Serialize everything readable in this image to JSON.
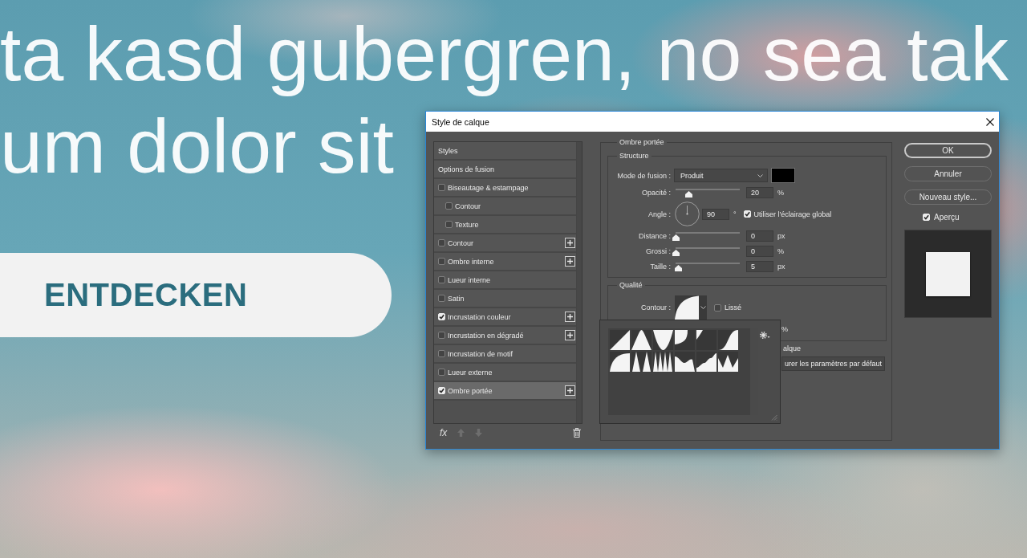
{
  "backdrop": {
    "headline": [
      "ta kasd gubergren, no sea tak",
      "um dolor sit"
    ],
    "button": {
      "label": "ENTDECKEN"
    }
  },
  "dialog": {
    "title": "Style de calque",
    "effects": [
      {
        "kind": "header",
        "label": "Styles",
        "selected": false
      },
      {
        "kind": "header",
        "label": "Options de fusion",
        "selected": false
      },
      {
        "kind": "effect",
        "label": "Biseautage & estampage",
        "checked": false,
        "addable": false,
        "selected": false,
        "children": [
          {
            "kind": "effect",
            "label": "Contour",
            "checked": false,
            "addable": false,
            "selected": false
          },
          {
            "kind": "effect",
            "label": "Texture",
            "checked": false,
            "addable": false,
            "selected": false
          }
        ]
      },
      {
        "kind": "effect",
        "label": "Contour",
        "checked": false,
        "addable": true,
        "selected": false
      },
      {
        "kind": "effect",
        "label": "Ombre interne",
        "checked": false,
        "addable": true,
        "selected": false
      },
      {
        "kind": "effect",
        "label": "Lueur interne",
        "checked": false,
        "addable": false,
        "selected": false
      },
      {
        "kind": "effect",
        "label": "Satin",
        "checked": false,
        "addable": false,
        "selected": false
      },
      {
        "kind": "effect",
        "label": "Incrustation couleur",
        "checked": true,
        "addable": true,
        "selected": false
      },
      {
        "kind": "effect",
        "label": "Incrustation en dégradé",
        "checked": false,
        "addable": true,
        "selected": false
      },
      {
        "kind": "effect",
        "label": "Incrustation de motif",
        "checked": false,
        "addable": false,
        "selected": false
      },
      {
        "kind": "effect",
        "label": "Lueur externe",
        "checked": false,
        "addable": false,
        "selected": false
      },
      {
        "kind": "effect",
        "label": "Ombre portée",
        "checked": true,
        "addable": true,
        "selected": true
      }
    ],
    "effects_toolbar": [
      {
        "kind": "fx",
        "label": "fx",
        "disabled": false
      },
      {
        "kind": "move_up",
        "disabled": true
      },
      {
        "kind": "move_down",
        "disabled": true
      },
      {
        "kind": "delete",
        "disabled": false
      }
    ],
    "panel": {
      "title": "Ombre portée",
      "structure": {
        "title": "Structure",
        "rows": [
          {
            "kind": "select",
            "label": "Mode de fusion :",
            "value": "Produit",
            "color": "#000000"
          },
          {
            "kind": "slider",
            "label": "Opacité :",
            "level": 0.2,
            "value": "20",
            "unit": "%"
          },
          {
            "kind": "angle",
            "label": "Angle :",
            "value": "90",
            "unit": "°",
            "option": {
              "label": "Utiliser l'éclairage global",
              "checked": true
            }
          },
          {
            "kind": "slider",
            "label": "Distance :",
            "level": 0,
            "value": "0",
            "unit": "px"
          },
          {
            "kind": "slider",
            "label": "Grossi :",
            "level": 0,
            "value": "0",
            "unit": "%"
          },
          {
            "kind": "slider",
            "label": "Taille :",
            "level": 0.04,
            "value": "5",
            "unit": "px"
          }
        ]
      },
      "quality": {
        "title": "Qualité",
        "contour": {
          "label": "Contour :",
          "expanded": true
        },
        "smooth": {
          "label": "Lissé",
          "checked": false
        },
        "partial_unit": "%"
      },
      "partial_option": "alque",
      "partial_button": "urer les paramètres par défaut"
    },
    "buttons": [
      {
        "label": "OK",
        "default": true
      },
      {
        "label": "Annuler",
        "default": false
      },
      {
        "label": "Nouveau style...",
        "default": false
      }
    ],
    "preview": {
      "label": "Aperçu",
      "checked": true
    }
  }
}
